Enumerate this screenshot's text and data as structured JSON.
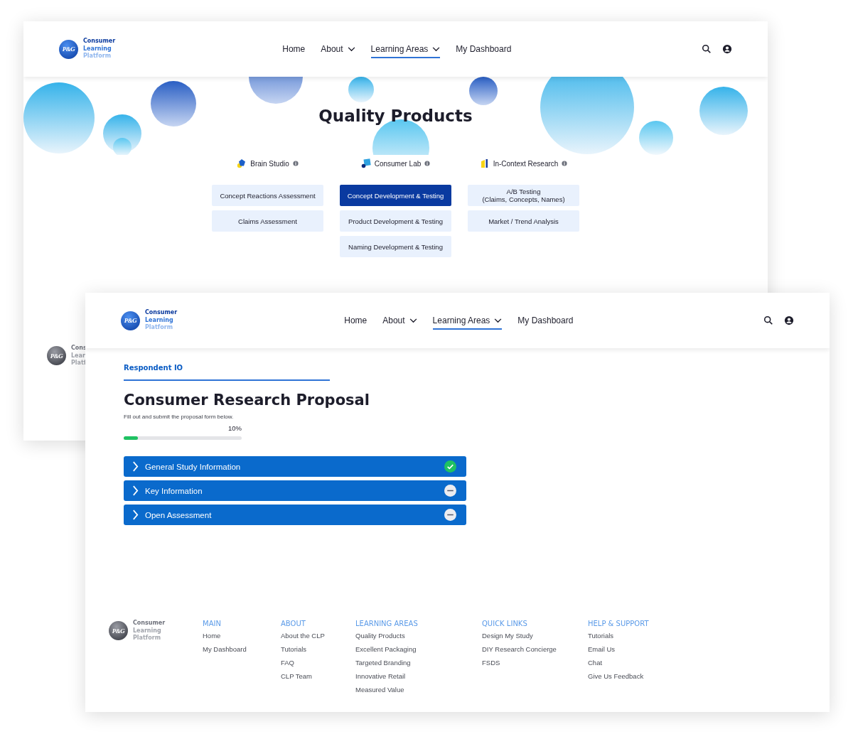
{
  "back_window": {
    "header": {
      "logo": {
        "mark": "P&G",
        "lines": [
          "Consumer",
          "Learning",
          "Platform"
        ]
      },
      "nav": [
        {
          "label": "Home",
          "selected": false,
          "dropdown": false
        },
        {
          "label": "About",
          "selected": false,
          "dropdown": true
        },
        {
          "label": "Learning Areas",
          "selected": true,
          "dropdown": true
        },
        {
          "label": "My Dashboard",
          "selected": false,
          "dropdown": false
        }
      ]
    },
    "hero_title": "Quality Products",
    "categories": [
      {
        "name": "Brain Studio",
        "kind": "pentagon",
        "items": [
          {
            "label": "Concept Reactions Assessment",
            "selected": false
          },
          {
            "label": "Claims Assessment",
            "selected": false
          }
        ]
      },
      {
        "name": "Consumer Lab",
        "kind": "square",
        "items": [
          {
            "label": "Concept Development & Testing",
            "selected": true
          },
          {
            "label": "Product Development & Testing",
            "selected": false
          },
          {
            "label": "Naming Development & Testing",
            "selected": false
          }
        ]
      },
      {
        "name": "In-Context Research",
        "kind": "bars",
        "items": [
          {
            "label": "A/B Testing\n(Claims, Concepts, Names)",
            "selected": false
          },
          {
            "label": "Market / Trend Analysis",
            "selected": false
          }
        ]
      }
    ],
    "footer_logo": {
      "mark": "P&G",
      "lines": [
        "Cons",
        "Lear",
        "Platf"
      ]
    }
  },
  "front_window": {
    "header": {
      "logo": {
        "mark": "P&G",
        "lines": [
          "Consumer",
          "Learning",
          "Platform"
        ]
      },
      "nav": [
        {
          "label": "Home",
          "selected": false,
          "dropdown": false
        },
        {
          "label": "About",
          "selected": false,
          "dropdown": true
        },
        {
          "label": "Learning Areas",
          "selected": true,
          "dropdown": true
        },
        {
          "label": "My Dashboard",
          "selected": false,
          "dropdown": false
        }
      ]
    },
    "breadcrumb": "Respondent IO",
    "title": "Consumer Research Proposal",
    "subtitle": "Fill out and submit the proposal form below.",
    "progress": {
      "reading": "10%",
      "level": 0.12
    },
    "sections": [
      {
        "label": "General Study Information",
        "complete": true
      },
      {
        "label": "Key Information",
        "complete": false
      },
      {
        "label": "Open Assessment",
        "complete": false
      }
    ],
    "footer": {
      "logo": {
        "mark": "P&G",
        "lines": [
          "Consumer",
          "Learning",
          "Platform"
        ]
      },
      "columns": [
        {
          "heading": "MAIN",
          "links": [
            "Home",
            "My Dashboard"
          ]
        },
        {
          "heading": "ABOUT",
          "links": [
            "About the CLP",
            "Tutorials",
            "FAQ",
            "CLP Team"
          ]
        },
        {
          "heading": "LEARNING AREAS",
          "links": [
            "Quality Products",
            "Excellent Packaging",
            "Targeted Branding",
            "Innovative Retail",
            "Measured Value"
          ]
        },
        {
          "heading": "QUICK LINKS",
          "links": [
            "Design My Study",
            "DIY Research Concierge",
            "FSDS"
          ]
        },
        {
          "heading": "HELP & SUPPORT",
          "links": [
            "Tutorials",
            "Email Us",
            "Chat",
            "Give Us Feedback"
          ]
        }
      ]
    }
  }
}
